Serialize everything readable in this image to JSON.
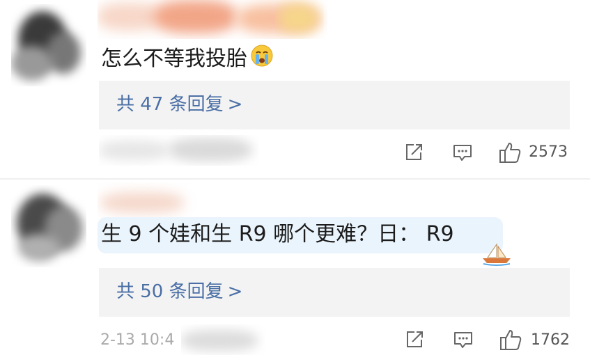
{
  "comments": [
    {
      "text": "怎么不等我投胎",
      "reply_label": "共 47 条回复",
      "reply_arrow": ">",
      "like_count": "2573",
      "icons": {
        "emoji": "loudly-crying-emoji",
        "share": "share-icon",
        "comment": "comment-icon",
        "like": "thumbs-up-icon"
      }
    },
    {
      "text": "生 9 个娃和生 R9 哪个更难？日： R9",
      "reply_label": "共 50 条回复",
      "reply_arrow": ">",
      "date": "2-13 10:4",
      "like_count": "1762",
      "icons": {
        "badge": "sailboat-badge-icon",
        "share": "share-icon",
        "comment": "comment-icon",
        "like": "thumbs-up-icon"
      }
    }
  ],
  "colors": {
    "link": "#4a6fa5",
    "highlight": "#eaf4fc",
    "reply_bg": "#f3f3f3",
    "icon": "#666666"
  }
}
